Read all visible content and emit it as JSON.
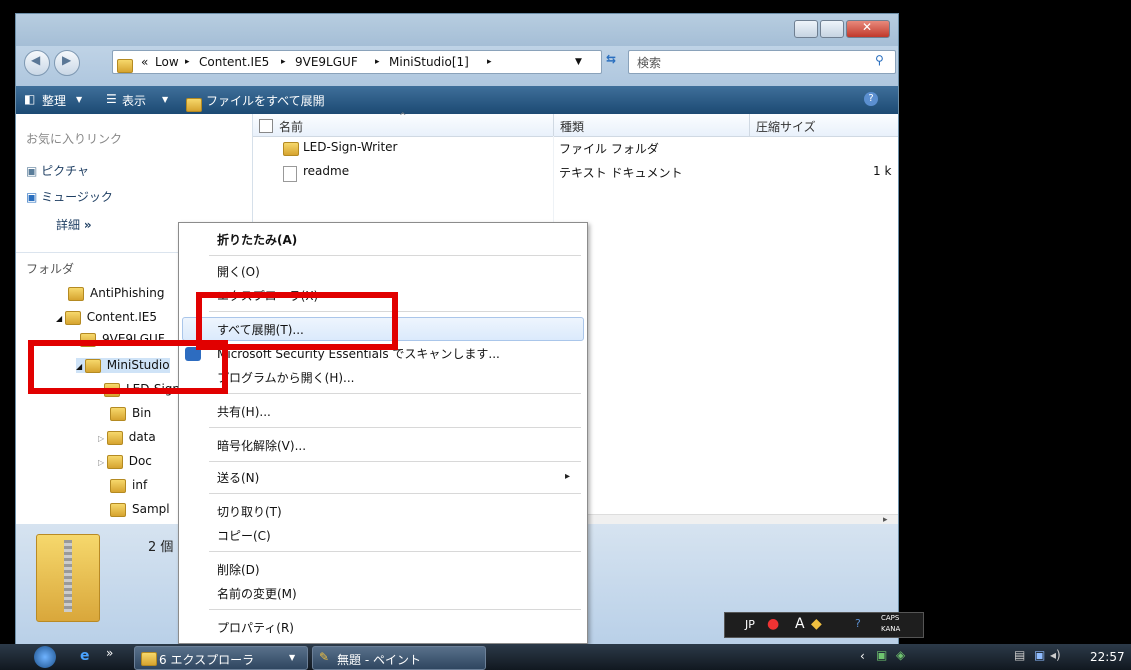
{
  "window": {
    "breadcrumb": {
      "prefix": "«",
      "items": [
        "Low",
        "Content.IE5",
        "9VE9LGUF",
        "MiniStudio[1]"
      ],
      "separator": "▸"
    },
    "search_placeholder": "検索",
    "toolbar": {
      "organize": "整理",
      "view": "表示",
      "extract_all": "ファイルをすべて展開",
      "help": "?"
    }
  },
  "navpane": {
    "favorites_title": "お気に入りリンク",
    "favorites": [
      "ピクチャ",
      "ミュージック"
    ],
    "more": "詳細",
    "more_chevron": "»",
    "folders_title": "フォルダ",
    "tree": [
      {
        "label": "AntiPhishing"
      },
      {
        "label": "Content.IE5"
      },
      {
        "label": "9VE9LGUF"
      },
      {
        "label": "MiniStudio"
      },
      {
        "label": "LED-Sign"
      },
      {
        "label": "Bin"
      },
      {
        "label": "data"
      },
      {
        "label": "Doc"
      },
      {
        "label": "inf"
      },
      {
        "label": "Sampl"
      }
    ]
  },
  "content": {
    "columns": {
      "name": "名前",
      "type": "種類",
      "size": "圧縮サイズ"
    },
    "rows": [
      {
        "name": "LED-Sign-Writer",
        "type": "ファイル フォルダ",
        "size": ""
      },
      {
        "name": "readme",
        "type": "テキスト ドキュメント",
        "size": "1 k"
      }
    ]
  },
  "details": {
    "count_text": "2 個"
  },
  "context_menu": {
    "items": [
      {
        "label": "折りたたみ(A)",
        "bold": true
      },
      {
        "label": "開く(O)"
      },
      {
        "label": "エクスプローラ(X)"
      },
      {
        "label": "すべて展開(T)...",
        "highlighted": true
      },
      {
        "label": "Microsoft Security Essentials でスキャンします..."
      },
      {
        "label": "プログラムから開く(H)..."
      },
      {
        "label": "共有(H)..."
      },
      {
        "label": "暗号化解除(V)..."
      },
      {
        "label": "送る(N)"
      },
      {
        "label": "切り取り(T)"
      },
      {
        "label": "コピー(C)"
      },
      {
        "label": "削除(D)"
      },
      {
        "label": "名前の変更(M)"
      },
      {
        "label": "プロパティ(R)"
      }
    ],
    "submenu_arrow": "▸"
  },
  "language_bar": {
    "lang": "JP",
    "caps": "CAPS",
    "kana": "KANA"
  },
  "taskbar": {
    "explorer_group": "6 エクスプローラ",
    "paint": "無題 - ペイント",
    "clock": "22:57"
  },
  "colors": {
    "highlight_box": "#e10000",
    "toolbar": "#1c4a73"
  }
}
